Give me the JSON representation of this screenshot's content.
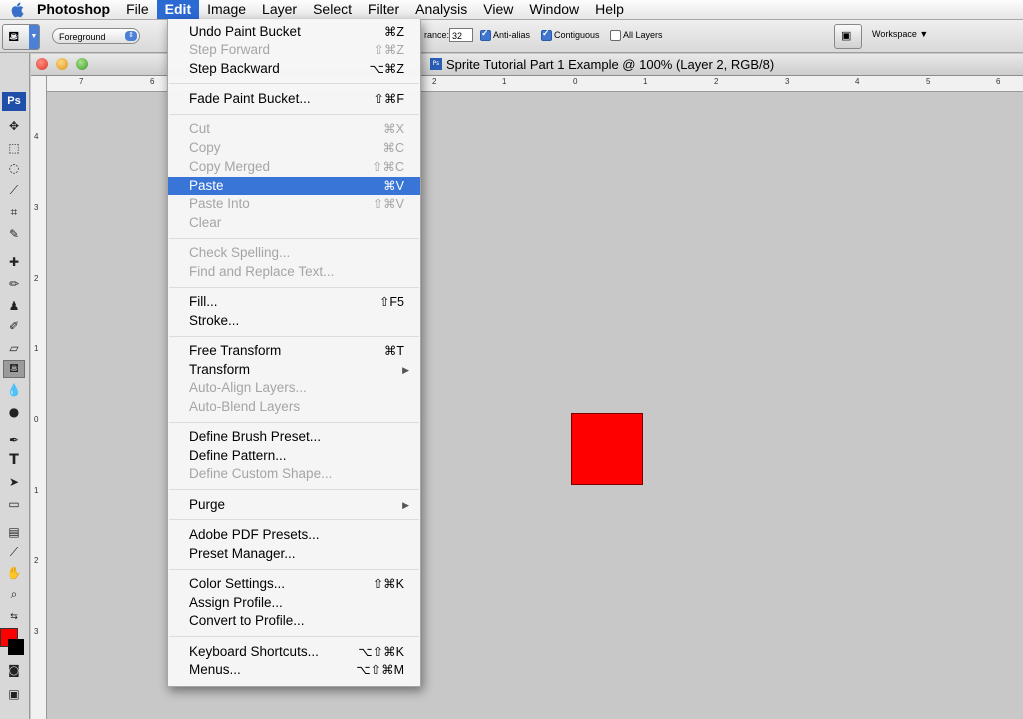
{
  "menubar": {
    "app": "Photoshop",
    "items": [
      "File",
      "Edit",
      "Image",
      "Layer",
      "Select",
      "Filter",
      "Analysis",
      "View",
      "Window",
      "Help"
    ],
    "active": "Edit"
  },
  "options": {
    "fill_source": "Foreground",
    "tolerance_label": "rance:",
    "tolerance_value": "32",
    "anti_alias": "Anti-alias",
    "contiguous": "Contiguous",
    "all_layers": "All Layers",
    "workspace": "Workspace ▼"
  },
  "document": {
    "title": "Sprite Tutorial Part 1 Example @ 100% (Layer 2, RGB/8)",
    "ps_badge": "Ps",
    "square_color": "#ff0000",
    "ruler_top": [
      "7",
      "6",
      "2",
      "1",
      "0",
      "1",
      "2",
      "3",
      "4",
      "5",
      "6"
    ],
    "ruler_left": [
      "4",
      "3",
      "2",
      "1",
      "0",
      "1",
      "2",
      "3"
    ]
  },
  "colors": {
    "foreground": "#ff0000",
    "background": "#000000",
    "highlight": "#3875d7"
  },
  "edit_menu": {
    "items": [
      {
        "label": "Undo Paint Bucket",
        "shortcut": "⌘Z",
        "disabled": false
      },
      {
        "label": "Step Forward",
        "shortcut": "⇧⌘Z",
        "disabled": true
      },
      {
        "label": "Step Backward",
        "shortcut": "⌥⌘Z",
        "disabled": false
      },
      {
        "label": "Fade Paint Bucket...",
        "shortcut": "⇧⌘F",
        "disabled": false
      },
      {
        "label": "Cut",
        "shortcut": "⌘X",
        "disabled": true
      },
      {
        "label": "Copy",
        "shortcut": "⌘C",
        "disabled": true
      },
      {
        "label": "Copy Merged",
        "shortcut": "⇧⌘C",
        "disabled": true
      },
      {
        "label": "Paste",
        "shortcut": "⌘V",
        "disabled": false,
        "highlighted": true
      },
      {
        "label": "Paste Into",
        "shortcut": "⇧⌘V",
        "disabled": true
      },
      {
        "label": "Clear",
        "shortcut": "",
        "disabled": true
      },
      {
        "label": "Check Spelling...",
        "shortcut": "",
        "disabled": true
      },
      {
        "label": "Find and Replace Text...",
        "shortcut": "",
        "disabled": true
      },
      {
        "label": "Fill...",
        "shortcut": "⇧F5",
        "disabled": false
      },
      {
        "label": "Stroke...",
        "shortcut": "",
        "disabled": false
      },
      {
        "label": "Free Transform",
        "shortcut": "⌘T",
        "disabled": false
      },
      {
        "label": "Transform",
        "shortcut": "",
        "disabled": false,
        "submenu": true
      },
      {
        "label": "Auto-Align Layers...",
        "shortcut": "",
        "disabled": true
      },
      {
        "label": "Auto-Blend Layers",
        "shortcut": "",
        "disabled": true
      },
      {
        "label": "Define Brush Preset...",
        "shortcut": "",
        "disabled": false
      },
      {
        "label": "Define Pattern...",
        "shortcut": "",
        "disabled": false
      },
      {
        "label": "Define Custom Shape...",
        "shortcut": "",
        "disabled": true
      },
      {
        "label": "Purge",
        "shortcut": "",
        "disabled": false,
        "submenu": true
      },
      {
        "label": "Adobe PDF Presets...",
        "shortcut": "",
        "disabled": false
      },
      {
        "label": "Preset Manager...",
        "shortcut": "",
        "disabled": false
      },
      {
        "label": "Color Settings...",
        "shortcut": "⇧⌘K",
        "disabled": false
      },
      {
        "label": "Assign Profile...",
        "shortcut": "",
        "disabled": false
      },
      {
        "label": "Convert to Profile...",
        "shortcut": "",
        "disabled": false
      },
      {
        "label": "Keyboard Shortcuts...",
        "shortcut": "⌥⇧⌘K",
        "disabled": false
      },
      {
        "label": "Menus...",
        "shortcut": "⌥⇧⌘M",
        "disabled": false
      }
    ]
  }
}
